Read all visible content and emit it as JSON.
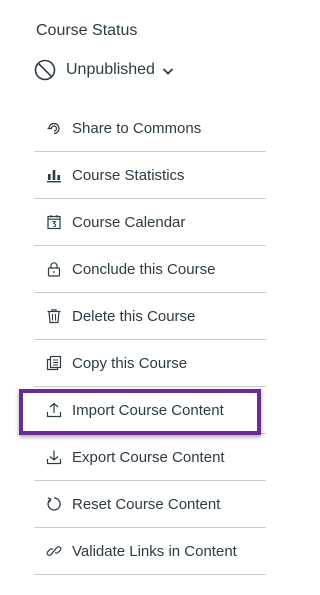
{
  "status": {
    "title": "Course Status",
    "value": "Unpublished"
  },
  "actions": [
    {
      "label": "Share to Commons",
      "icon": "commons-icon"
    },
    {
      "label": "Course Statistics",
      "icon": "statistics-icon"
    },
    {
      "label": "Course Calendar",
      "icon": "calendar-icon"
    },
    {
      "label": "Conclude this Course",
      "icon": "lock-icon"
    },
    {
      "label": "Delete this Course",
      "icon": "trash-icon"
    },
    {
      "label": "Copy this Course",
      "icon": "copy-icon"
    },
    {
      "label": "Import Course Content",
      "icon": "import-icon"
    },
    {
      "label": "Export Course Content",
      "icon": "export-icon"
    },
    {
      "label": "Reset Course Content",
      "icon": "reset-icon"
    },
    {
      "label": "Validate Links in Content",
      "icon": "link-icon"
    }
  ],
  "colors": {
    "text": "#2d3b45",
    "divider": "#c7cdd1",
    "highlight_border": "#6a2c91"
  }
}
